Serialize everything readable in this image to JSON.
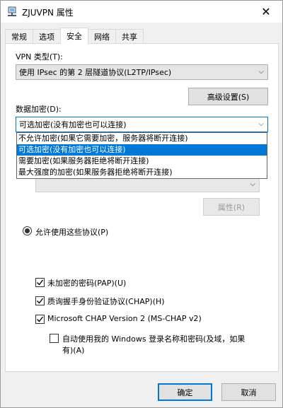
{
  "window": {
    "title": "ZJUVPN 属性",
    "close_symbol": "✕"
  },
  "tabs": [
    {
      "label": "常规",
      "active": false
    },
    {
      "label": "选项",
      "active": false
    },
    {
      "label": "安全",
      "active": true
    },
    {
      "label": "网络",
      "active": false
    },
    {
      "label": "共享",
      "active": false
    }
  ],
  "vpn_type": {
    "label": "VPN 类型(T):",
    "value": "使用 IPsec 的第 2 层隧道协议(L2TP/IPsec)"
  },
  "advanced_button": "高级设置(S)",
  "encryption": {
    "label": "数据加密(D):",
    "value": "可选加密(没有加密也可以连接)",
    "options": [
      {
        "label": "不允许加密(如果它需要加密，服务器将断开连接)",
        "selected": false
      },
      {
        "label": "可选加密(没有加密也可以连接)",
        "selected": true
      },
      {
        "label": "需要加密(如果服务器拒绝将断开连接)",
        "selected": false
      },
      {
        "label": "最大强度的加密(如果服务器拒绝将断开连接)",
        "selected": false
      }
    ]
  },
  "properties_button": "属性(R)",
  "allow_protocols": {
    "label": "允许使用这些协议(P)",
    "checked": true
  },
  "protocols": [
    {
      "label": "未加密的密码(PAP)(U)",
      "checked": true
    },
    {
      "label": "质询握手身份验证协议(CHAP)(H)",
      "checked": true
    },
    {
      "label": "Microsoft CHAP Version 2 (MS-CHAP v2)",
      "checked": true
    }
  ],
  "auto_logon": {
    "label_line1": "自动使用我的 Windows 登录名称和密码(及域，如果",
    "label_line2": "有)(A)",
    "checked": false
  },
  "footer": {
    "ok_label": "确定",
    "cancel_label": "取消"
  },
  "colors": {
    "accent": "#0078d7",
    "panel_bg": "#ffffff",
    "window_bg": "#f0f0f0"
  }
}
